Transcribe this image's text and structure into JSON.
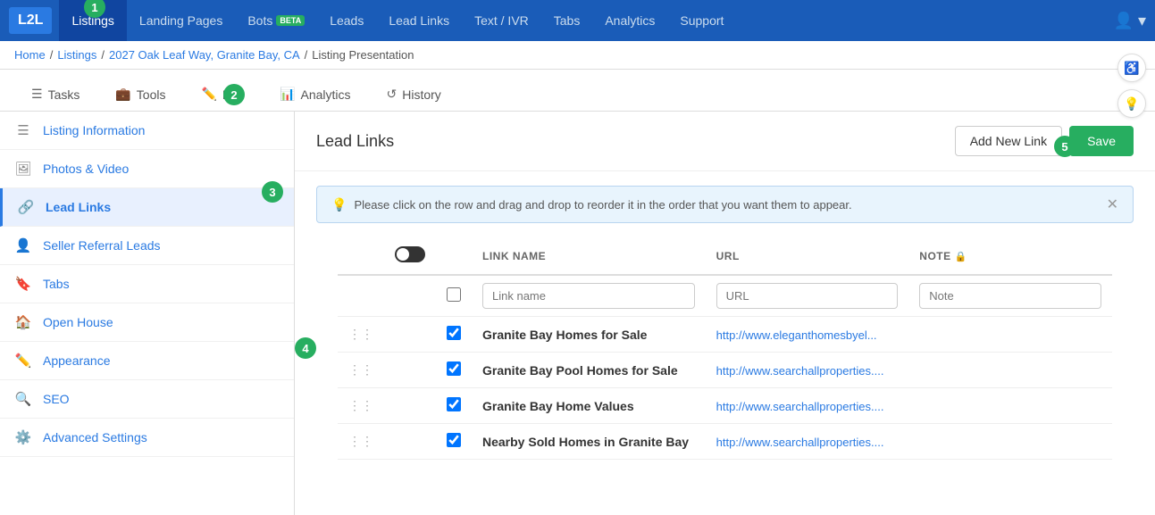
{
  "logo": "L2L",
  "nav": {
    "items": [
      {
        "label": "Listings",
        "active": true
      },
      {
        "label": "Landing Pages",
        "active": false
      },
      {
        "label": "Bots",
        "active": false,
        "badge": "BETA"
      },
      {
        "label": "Leads",
        "active": false
      },
      {
        "label": "Lead Links",
        "active": false
      },
      {
        "label": "Text / IVR",
        "active": false
      },
      {
        "label": "Tabs",
        "active": false
      },
      {
        "label": "Analytics",
        "active": false
      },
      {
        "label": "Support",
        "active": false
      }
    ],
    "user_icon": "👤"
  },
  "breadcrumb": {
    "home": "Home",
    "sep1": "/",
    "listings": "Listings",
    "sep2": "/",
    "address": "2027 Oak Leaf Way, Granite Bay, CA",
    "sep3": "/",
    "current": "Listing Presentation"
  },
  "tabs": [
    {
      "label": "Tasks",
      "icon": "☰",
      "active": false
    },
    {
      "label": "Tools",
      "icon": "💼",
      "active": false
    },
    {
      "label": "Edit",
      "icon": "✏️",
      "active": false
    },
    {
      "label": "Analytics",
      "icon": "📊",
      "active": false
    },
    {
      "label": "History",
      "icon": "↺",
      "active": false
    }
  ],
  "sidebar": {
    "items": [
      {
        "label": "Listing Information",
        "icon": "☰"
      },
      {
        "label": "Photos & Video",
        "icon": "🖼"
      },
      {
        "label": "Lead Links",
        "icon": "🔗",
        "active": true
      },
      {
        "label": "Seller Referral Leads",
        "icon": "👤"
      },
      {
        "label": "Tabs",
        "icon": "🔖"
      },
      {
        "label": "Open House",
        "icon": "🏠"
      },
      {
        "label": "Appearance",
        "icon": "✏️"
      },
      {
        "label": "SEO",
        "icon": "🔍"
      },
      {
        "label": "Advanced Settings",
        "icon": "⚙️"
      }
    ]
  },
  "main": {
    "title": "Lead Links",
    "add_button": "Add New Link",
    "save_button": "Save",
    "info_message": "Please click on the row and drag and drop to reorder it in the order that you want them to appear.",
    "table": {
      "columns": [
        "LINK NAME",
        "URL",
        "NOTE 🔒"
      ],
      "input_row": {
        "link_placeholder": "Link name",
        "url_placeholder": "URL",
        "note_placeholder": "Note"
      },
      "rows": [
        {
          "name": "Granite Bay Homes for Sale",
          "url": "http://www.eleganthomesbyel...",
          "url_full": "http://www.eleganthomesbyel...",
          "checked": true
        },
        {
          "name": "Granite Bay Pool Homes for Sale",
          "url": "http://www.searchallproperties....",
          "url_full": "http://www.searchallproperties....",
          "checked": true
        },
        {
          "name": "Granite Bay Home Values",
          "url": "http://www.searchallproperties....",
          "url_full": "http://www.searchallproperties....",
          "checked": true
        },
        {
          "name": "Nearby Sold Homes in Granite Bay",
          "url": "http://www.searchallproperties....",
          "url_full": "http://www.searchallproperties....",
          "checked": true
        }
      ]
    }
  },
  "steps": [
    {
      "number": "1"
    },
    {
      "number": "2"
    },
    {
      "number": "3"
    },
    {
      "number": "4"
    },
    {
      "number": "5"
    }
  ]
}
